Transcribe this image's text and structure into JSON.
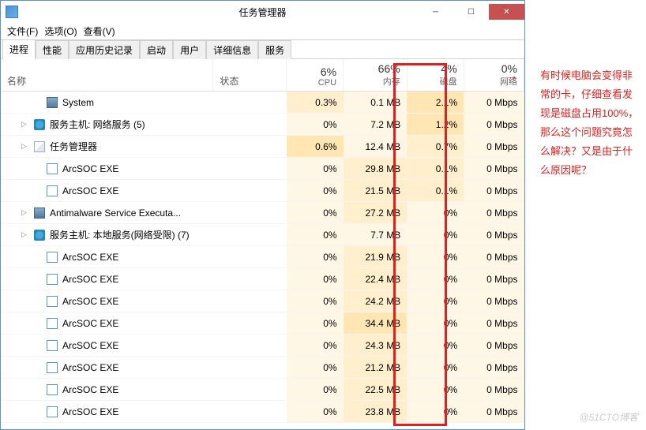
{
  "window": {
    "title": "任务管理器"
  },
  "menu": {
    "file": "文件(F)",
    "options": "选项(O)",
    "view": "查看(V)"
  },
  "tabs": [
    "进程",
    "性能",
    "应用历史记录",
    "启动",
    "用户",
    "详细信息",
    "服务"
  ],
  "columns": {
    "name": "名称",
    "status": "状态",
    "cpu": {
      "pct": "6%",
      "label": "CPU"
    },
    "mem": {
      "pct": "66%",
      "label": "内存"
    },
    "disk": {
      "pct": "4%",
      "label": "磁盘"
    },
    "net": {
      "pct": "0%",
      "label": "网络"
    }
  },
  "rows": [
    {
      "exp": "",
      "icon": "sys",
      "name": "System",
      "cpu": "0.3%",
      "mem": "0.1 MB",
      "disk": "2.1%",
      "net": "0 Mbps",
      "h": [
        1,
        0,
        2,
        0
      ]
    },
    {
      "exp": "▷",
      "icon": "gear",
      "name": "服务主机: 网络服务 (5)",
      "cpu": "0%",
      "mem": "7.2 MB",
      "disk": "1.2%",
      "net": "0 Mbps",
      "h": [
        0,
        0,
        2,
        0
      ]
    },
    {
      "exp": "▷",
      "icon": "tm",
      "name": "任务管理器",
      "cpu": "0.6%",
      "mem": "12.4 MB",
      "disk": "0.7%",
      "net": "0 Mbps",
      "h": [
        2,
        0,
        1,
        0
      ]
    },
    {
      "exp": "",
      "icon": "app",
      "name": "ArcSOC EXE",
      "cpu": "0%",
      "mem": "29.8 MB",
      "disk": "0.1%",
      "net": "0 Mbps",
      "h": [
        0,
        1,
        1,
        0
      ]
    },
    {
      "exp": "",
      "icon": "app",
      "name": "ArcSOC EXE",
      "cpu": "0%",
      "mem": "21.5 MB",
      "disk": "0.1%",
      "net": "0 Mbps",
      "h": [
        0,
        1,
        1,
        0
      ]
    },
    {
      "exp": "▷",
      "icon": "sys",
      "name": "Antimalware Service Executa...",
      "cpu": "0%",
      "mem": "27.2 MB",
      "disk": "0%",
      "net": "0 Mbps",
      "h": [
        0,
        1,
        0,
        0
      ]
    },
    {
      "exp": "▷",
      "icon": "gear",
      "name": "服务主机: 本地服务(网络受限) (7)",
      "cpu": "0%",
      "mem": "7.7 MB",
      "disk": "0%",
      "net": "0 Mbps",
      "h": [
        0,
        0,
        0,
        0
      ]
    },
    {
      "exp": "",
      "icon": "app",
      "name": "ArcSOC EXE",
      "cpu": "0%",
      "mem": "21.9 MB",
      "disk": "0%",
      "net": "0 Mbps",
      "h": [
        0,
        1,
        0,
        0
      ]
    },
    {
      "exp": "",
      "icon": "app",
      "name": "ArcSOC EXE",
      "cpu": "0%",
      "mem": "22.4 MB",
      "disk": "0%",
      "net": "0 Mbps",
      "h": [
        0,
        1,
        0,
        0
      ]
    },
    {
      "exp": "",
      "icon": "app",
      "name": "ArcSOC EXE",
      "cpu": "0%",
      "mem": "24.2 MB",
      "disk": "0%",
      "net": "0 Mbps",
      "h": [
        0,
        1,
        0,
        0
      ]
    },
    {
      "exp": "",
      "icon": "app",
      "name": "ArcSOC EXE",
      "cpu": "0%",
      "mem": "34.4 MB",
      "disk": "0%",
      "net": "0 Mbps",
      "h": [
        0,
        2,
        0,
        0
      ]
    },
    {
      "exp": "",
      "icon": "app",
      "name": "ArcSOC EXE",
      "cpu": "0%",
      "mem": "24.3 MB",
      "disk": "0%",
      "net": "0 Mbps",
      "h": [
        0,
        1,
        0,
        0
      ]
    },
    {
      "exp": "",
      "icon": "app",
      "name": "ArcSOC EXE",
      "cpu": "0%",
      "mem": "21.2 MB",
      "disk": "0%",
      "net": "0 Mbps",
      "h": [
        0,
        1,
        0,
        0
      ]
    },
    {
      "exp": "",
      "icon": "app",
      "name": "ArcSOC EXE",
      "cpu": "0%",
      "mem": "22.5 MB",
      "disk": "0%",
      "net": "0 Mbps",
      "h": [
        0,
        1,
        0,
        0
      ]
    },
    {
      "exp": "",
      "icon": "app",
      "name": "ArcSOC EXE",
      "cpu": "0%",
      "mem": "23.8 MB",
      "disk": "0%",
      "net": "0 Mbps",
      "h": [
        0,
        1,
        0,
        0
      ]
    }
  ],
  "annotation": "有时候电脑会变得非常的卡，仔细查看发现是磁盘占用100%，那么这个问题究竟怎么解决？又是由于什么原因呢？",
  "watermark": "@51CTO博客"
}
